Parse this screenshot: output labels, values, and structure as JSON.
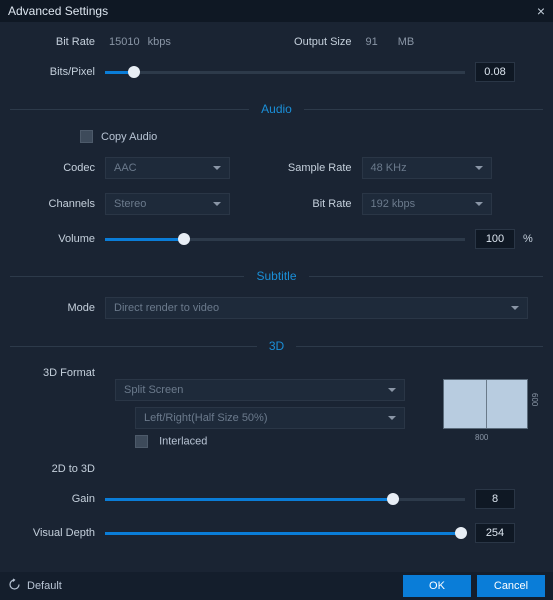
{
  "titlebar": {
    "title": "Advanced Settings"
  },
  "video": {
    "bitrate_label": "Bit Rate",
    "bitrate_value": "15010",
    "bitrate_unit": "kbps",
    "output_size_label": "Output Size",
    "output_size_value": "91",
    "output_size_unit": "MB",
    "bits_pixel_label": "Bits/Pixel",
    "bits_pixel_value": "0.08"
  },
  "audio": {
    "section": "Audio",
    "copy_audio": "Copy Audio",
    "codec_label": "Codec",
    "codec_value": "AAC",
    "sample_rate_label": "Sample Rate",
    "sample_rate_value": "48 KHz",
    "channels_label": "Channels",
    "channels_value": "Stereo",
    "bitrate_label": "Bit Rate",
    "bitrate_value": "192 kbps",
    "volume_label": "Volume",
    "volume_value": "100",
    "volume_unit": "%"
  },
  "subtitle": {
    "section": "Subtitle",
    "mode_label": "Mode",
    "mode_value": "Direct render to video"
  },
  "three_d": {
    "section": "3D",
    "format_label": "3D Format",
    "format_value": "Split Screen",
    "layout_value": "Left/Right(Half Size 50%)",
    "interlaced": "Interlaced",
    "preview_w": "800",
    "preview_h": "600",
    "to3d_label": "2D to 3D",
    "gain_label": "Gain",
    "gain_value": "8",
    "depth_label": "Visual Depth",
    "depth_value": "254"
  },
  "footer": {
    "default": "Default",
    "ok": "OK",
    "cancel": "Cancel"
  }
}
